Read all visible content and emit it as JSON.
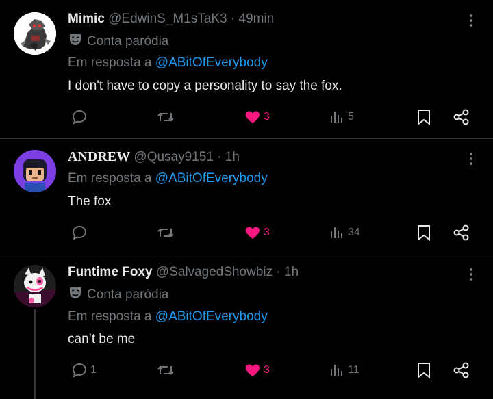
{
  "posts": [
    {
      "name": "Mimic",
      "handle": "@EdwinS_M1sTaK3",
      "separator": "·",
      "time": "49min",
      "parody_label": "Conta paródia",
      "reply_prefix": "Em resposta a",
      "reply_handle": "@ABitOfEverybody",
      "text": "I don't have to copy a personality to say the fox.",
      "reply_count": "",
      "repost_count": "",
      "like_count": "3",
      "view_count": "5"
    },
    {
      "name": "ANDREW",
      "handle": "@Qusay9151",
      "separator": "·",
      "time": "1h",
      "reply_prefix": "Em resposta a",
      "reply_handle": "@ABitOfEverybody",
      "text": "The fox",
      "reply_count": "",
      "repost_count": "",
      "like_count": "3",
      "view_count": "34"
    },
    {
      "name": "Funtime Foxy",
      "handle": "@SalvagedShowbiz",
      "separator": "·",
      "time": "1h",
      "parody_label": "Conta paródia",
      "reply_prefix": "Em resposta a",
      "reply_handle": "@ABitOfEverybody",
      "text": "can’t be me",
      "reply_count": "1",
      "repost_count": "",
      "like_count": "3",
      "view_count": "11"
    }
  ],
  "icons": {
    "parody": "theater-mask-icon",
    "more": "more-vertical-icon",
    "reply": "speech-bubble-icon",
    "repost": "repost-arrows-icon",
    "like": "heart-icon",
    "views": "bar-chart-icon",
    "bookmark": "bookmark-icon",
    "share": "share-icon"
  },
  "colors": {
    "background": "#000000",
    "text": "#e7e9ea",
    "muted": "#71767b",
    "mention": "#1d9bf0",
    "like": "#f91880",
    "divider": "#2f3336"
  }
}
